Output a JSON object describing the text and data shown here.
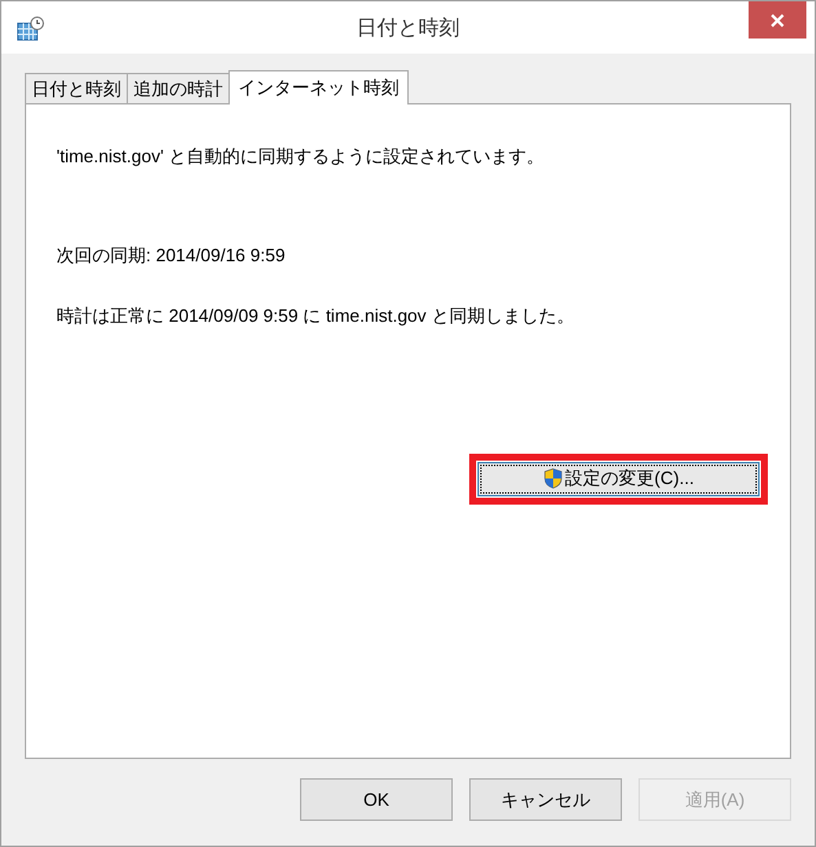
{
  "window": {
    "title": "日付と時刻"
  },
  "tabs": [
    {
      "label": "日付と時刻",
      "selected": false
    },
    {
      "label": "追加の時計",
      "selected": false
    },
    {
      "label": "インターネット時刻",
      "selected": true
    }
  ],
  "messages": [
    "'time.nist.gov' と自動的に同期するように設定されています。",
    "次回の同期: 2014/09/16 9:59",
    "時計は正常に 2014/09/09 9:59 に time.nist.gov と同期しました。"
  ],
  "change_button": {
    "label": "設定の変更(C)...",
    "highlighted": true
  },
  "buttons": [
    {
      "label": "OK",
      "disabled": false
    },
    {
      "label": "キャンセル",
      "disabled": false
    },
    {
      "label": "適用(A)",
      "disabled": true
    }
  ]
}
